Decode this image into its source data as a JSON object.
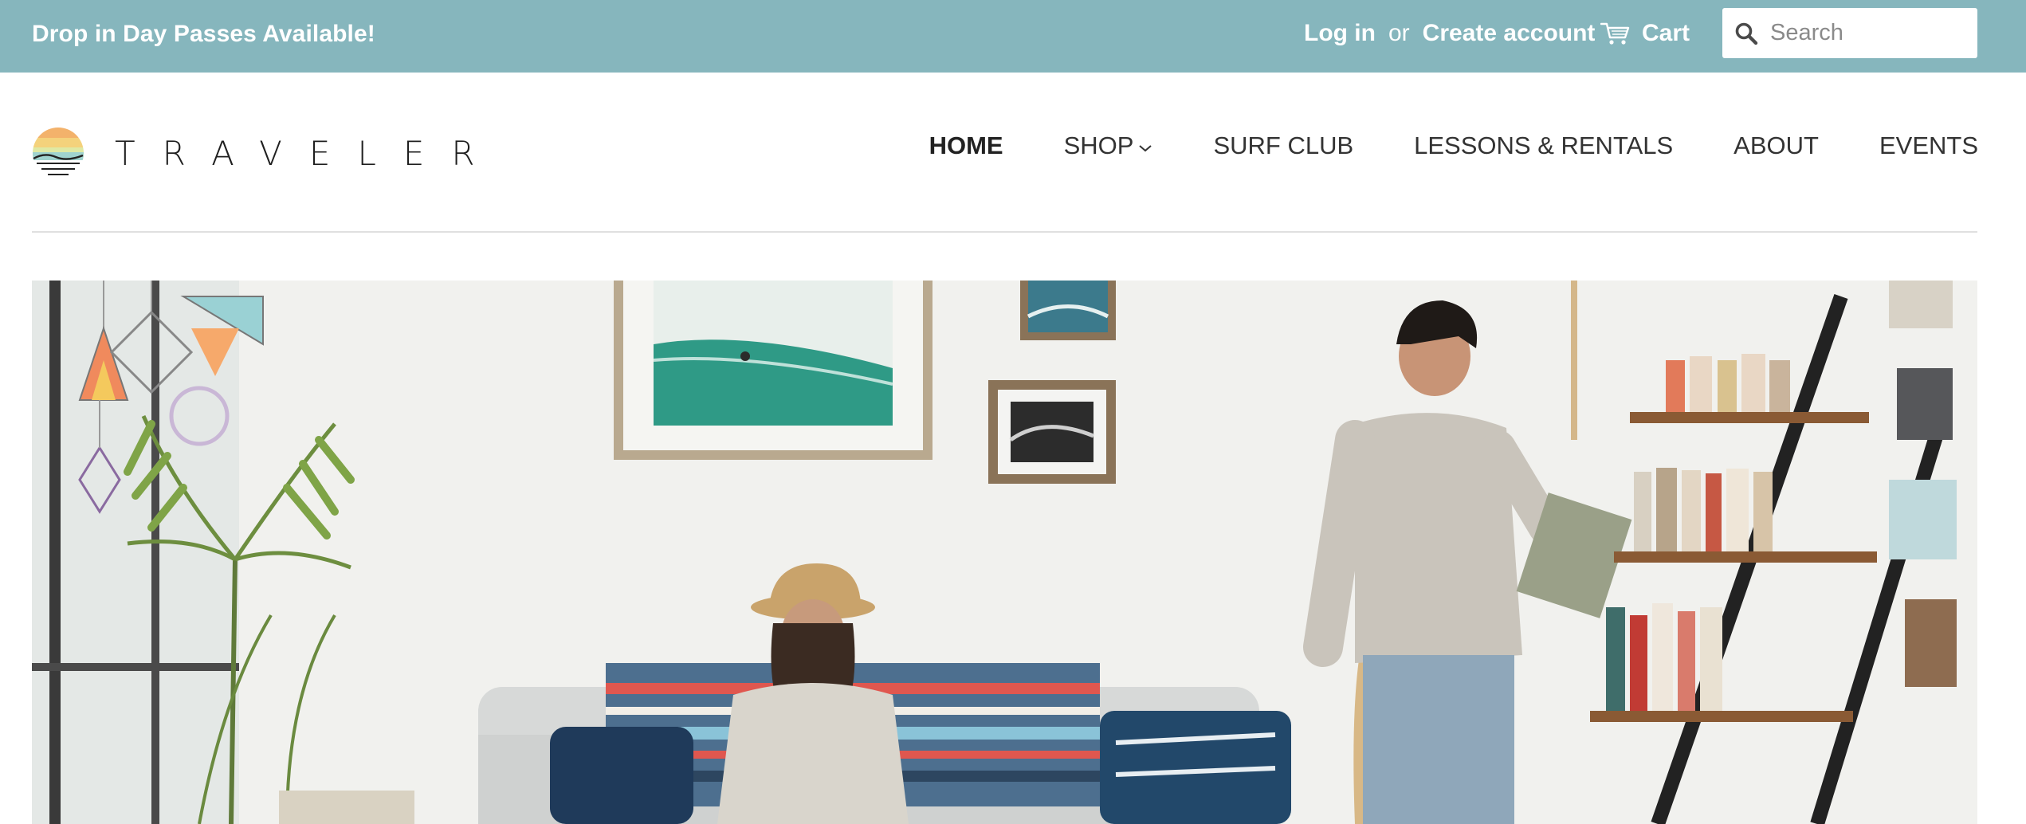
{
  "topbar": {
    "announcement": "Drop in Day Passes Available!",
    "login": "Log in",
    "or": "or",
    "create_account": "Create account",
    "cart": "Cart",
    "search_placeholder": "Search"
  },
  "brand": {
    "name": "TRAVELER"
  },
  "nav": {
    "items": [
      {
        "label": "HOME",
        "active": true
      },
      {
        "label": "SHOP",
        "dropdown": true
      },
      {
        "label": "SURF CLUB"
      },
      {
        "label": "LESSONS & RENTALS"
      },
      {
        "label": "ABOUT"
      },
      {
        "label": "EVENTS"
      }
    ]
  },
  "colors": {
    "topbar_bg": "#86b6bd",
    "text_dark": "#333333",
    "divider": "#e0e0e0"
  },
  "icons": {
    "cart": "cart-icon",
    "search": "search-icon",
    "dropdown": "chevron-down-icon",
    "logo": "sunset-logo-icon"
  }
}
